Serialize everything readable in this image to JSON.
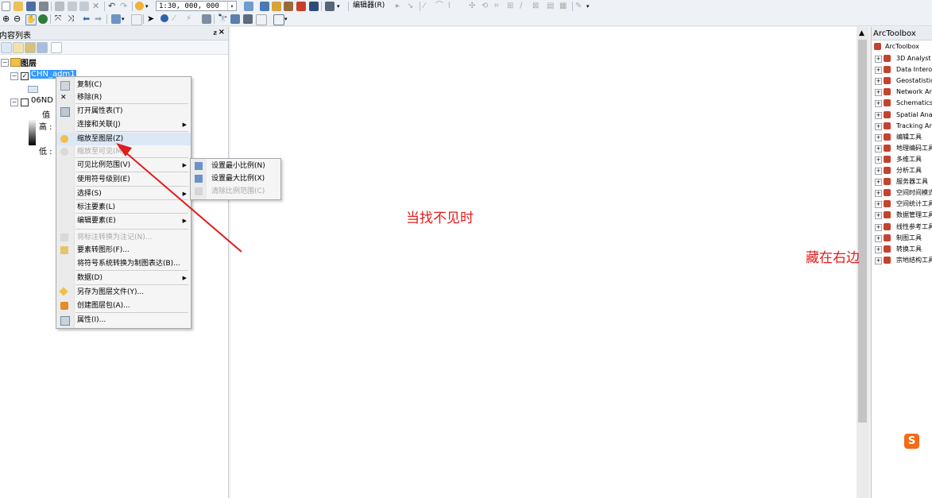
{
  "toolbar": {
    "scale_value": "1:30, 000, 000",
    "editor_menu": "编辑器(R)"
  },
  "toc": {
    "title": "内容列表",
    "pin_glyph": "ᵶ",
    "close_glyph": "×",
    "layers_root": "图层",
    "layer1": "CHN_adm1",
    "layer2": "06ND",
    "value_label": "值",
    "high_label": "高 :",
    "low_label": "低 :"
  },
  "context_menu": {
    "items": [
      {
        "label": "复制(C)",
        "icon": "copy-icon",
        "disabled": false
      },
      {
        "label": "移除(R)",
        "icon": "remove-icon",
        "disabled": false
      },
      {
        "label": "打开属性表(T)",
        "icon": "table-icon",
        "disabled": false
      },
      {
        "label": "连接和关联(J)",
        "icon": "",
        "disabled": false,
        "submenu": true
      },
      {
        "label": "缩放至图层(Z)",
        "icon": "zoom-layer-icon",
        "disabled": false
      },
      {
        "label": "缩放至可见(M)",
        "icon": "zoom-visible-icon",
        "disabled": true
      },
      {
        "label": "可见比例范围(V)",
        "icon": "",
        "disabled": false,
        "submenu": true
      },
      {
        "label": "使用符号级别(E)",
        "icon": "",
        "disabled": false
      },
      {
        "label": "选择(S)",
        "icon": "",
        "disabled": false,
        "submenu": true
      },
      {
        "label": "标注要素(L)",
        "icon": "",
        "disabled": false
      },
      {
        "label": "编辑要素(E)",
        "icon": "",
        "disabled": false,
        "submenu": true
      },
      {
        "label": "将标注转换为注记(N)...",
        "icon": "convert-label-icon",
        "disabled": true
      },
      {
        "label": "要素转图形(F)...",
        "icon": "feature-graphic-icon",
        "disabled": false
      },
      {
        "label": "将符号系统转换为制图表达(B)...",
        "icon": "",
        "disabled": false
      },
      {
        "label": "数据(D)",
        "icon": "",
        "disabled": false,
        "submenu": true
      },
      {
        "label": "另存为图层文件(Y)...",
        "icon": "layer-file-icon",
        "disabled": false
      },
      {
        "label": "创建图层包(A)...",
        "icon": "layer-package-icon",
        "disabled": false
      },
      {
        "label": "属性(I)...",
        "icon": "properties-icon",
        "disabled": false
      }
    ]
  },
  "submenu": {
    "items": [
      {
        "label": "设置最小比例(N)",
        "disabled": false
      },
      {
        "label": "设置最大比例(X)",
        "disabled": false
      },
      {
        "label": "清除比例范围(C)",
        "disabled": true
      }
    ]
  },
  "annotations": {
    "center_text": "当找不见时",
    "right_text": "藏在右边"
  },
  "arctoolbox": {
    "title": "ArcToolbox",
    "root": "ArcToolbox",
    "items": [
      "3D Analyst",
      "Data Interop",
      "Geostatistic",
      "Network An",
      "Schematics",
      "Spatial Anal",
      "Tracking An",
      "编辑工具",
      "地理编码工具",
      "多维工具",
      "分析工具",
      "服务器工具",
      "空间时间模式",
      "空间统计工具",
      "数据管理工具",
      "线性参考工具",
      "制图工具",
      "转换工具",
      "宗地结构工具"
    ]
  },
  "colors": {
    "annotation": "#e11c1c",
    "selection": "#3399ff",
    "toolbox_icon": "#c4432e"
  }
}
